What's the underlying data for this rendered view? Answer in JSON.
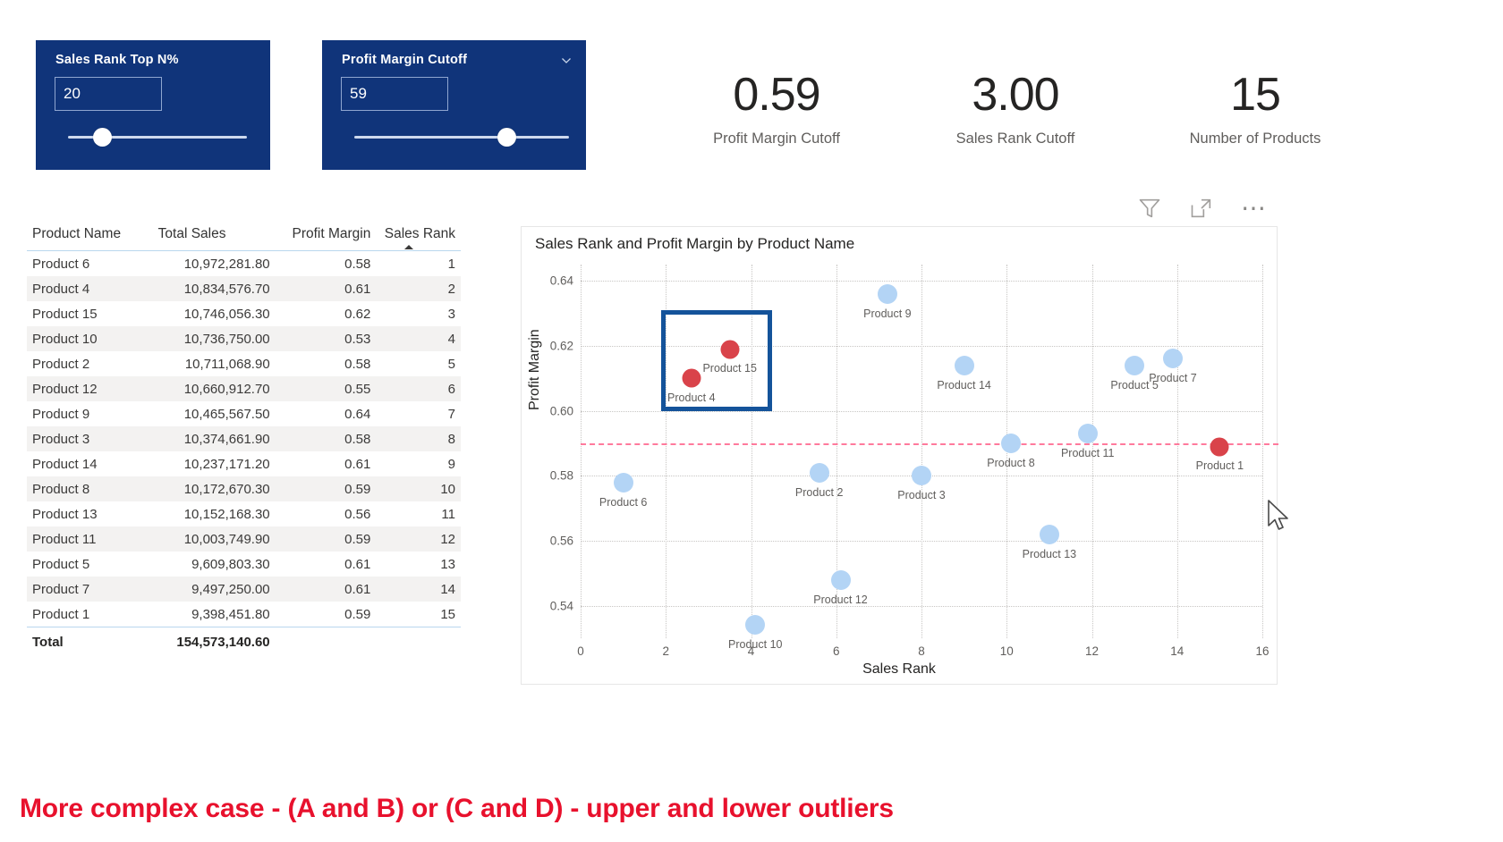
{
  "slicers": [
    {
      "name": "sales-rank-top-n",
      "title": "Sales Rank Top N%",
      "value": "20",
      "knob_pct": 19,
      "has_chevron": false
    },
    {
      "name": "profit-margin-cutoff",
      "title": "Profit Margin Cutoff",
      "value": "59",
      "knob_pct": 59,
      "has_chevron": true
    }
  ],
  "kpis": [
    {
      "value": "0.59",
      "label": "Profit Margin Cutoff"
    },
    {
      "value": "3.00",
      "label": "Sales Rank Cutoff"
    },
    {
      "value": "15",
      "label": "Number of Products"
    }
  ],
  "table": {
    "columns": [
      "Product Name",
      "Total Sales",
      "Profit Margin",
      "Sales Rank"
    ],
    "sorted_column": "Sales Rank",
    "rows": [
      [
        "Product 6",
        "10,972,281.80",
        "0.58",
        "1"
      ],
      [
        "Product 4",
        "10,834,576.70",
        "0.61",
        "2"
      ],
      [
        "Product 15",
        "10,746,056.30",
        "0.62",
        "3"
      ],
      [
        "Product 10",
        "10,736,750.00",
        "0.53",
        "4"
      ],
      [
        "Product 2",
        "10,711,068.90",
        "0.58",
        "5"
      ],
      [
        "Product 12",
        "10,660,912.70",
        "0.55",
        "6"
      ],
      [
        "Product 9",
        "10,465,567.50",
        "0.64",
        "7"
      ],
      [
        "Product 3",
        "10,374,661.90",
        "0.58",
        "8"
      ],
      [
        "Product 14",
        "10,237,171.20",
        "0.61",
        "9"
      ],
      [
        "Product 8",
        "10,172,670.30",
        "0.59",
        "10"
      ],
      [
        "Product 13",
        "10,152,168.30",
        "0.56",
        "11"
      ],
      [
        "Product 11",
        "10,003,749.90",
        "0.59",
        "12"
      ],
      [
        "Product 5",
        "9,609,803.30",
        "0.61",
        "13"
      ],
      [
        "Product 7",
        "9,497,250.00",
        "0.61",
        "14"
      ],
      [
        "Product 1",
        "9,398,451.80",
        "0.59",
        "15"
      ]
    ],
    "total_label": "Total",
    "total_value": "154,573,140.60"
  },
  "scatter": {
    "title": "Sales Rank and Profit Margin by Product Name",
    "toolbar": [
      "filter-icon",
      "focus-mode-icon",
      "more-options-icon"
    ],
    "colors": {
      "point_normal": "#b3d4f5",
      "point_highlight": "#d9434a",
      "cutoff_line": "#ff7a9c",
      "selection_box": "#14539a"
    }
  },
  "chart_data": {
    "type": "scatter",
    "title": "Sales Rank and Profit Margin by Product Name",
    "xlabel": "Sales Rank",
    "ylabel": "Profit Margin",
    "xlim": [
      0,
      16
    ],
    "ylim": [
      0.53,
      0.645
    ],
    "xticks": [
      0,
      2,
      4,
      6,
      8,
      10,
      12,
      14,
      16
    ],
    "yticks": [
      0.54,
      0.56,
      0.58,
      0.6,
      0.62,
      0.64
    ],
    "grid": true,
    "legend": "none",
    "reference_lines": [
      {
        "name": "profit-margin-cutoff",
        "orientation": "horizontal",
        "y": 0.59,
        "style": "dashed",
        "color": "#ff7a9c"
      }
    ],
    "annotations": [
      {
        "name": "selection-rectangle",
        "x0": 1.9,
        "x1": 4.5,
        "y0": 0.6,
        "y1": 0.631
      }
    ],
    "points": [
      {
        "label": "Product 6",
        "x": 1,
        "y": 0.578,
        "color": "#b3d4f5",
        "highlight": false
      },
      {
        "label": "Product 4",
        "x": 2.6,
        "y": 0.61,
        "color": "#d9434a",
        "highlight": true
      },
      {
        "label": "Product 15",
        "x": 3.5,
        "y": 0.619,
        "color": "#d9434a",
        "highlight": true
      },
      {
        "label": "Product 2",
        "x": 5.6,
        "y": 0.581,
        "color": "#b3d4f5",
        "highlight": false
      },
      {
        "label": "Product 10",
        "x": 4.1,
        "y": 0.534,
        "color": "#b3d4f5",
        "highlight": false
      },
      {
        "label": "Product 12",
        "x": 6.1,
        "y": 0.548,
        "color": "#b3d4f5",
        "highlight": false
      },
      {
        "label": "Product 9",
        "x": 7.2,
        "y": 0.636,
        "color": "#b3d4f5",
        "highlight": false
      },
      {
        "label": "Product 3",
        "x": 8.0,
        "y": 0.58,
        "color": "#b3d4f5",
        "highlight": false
      },
      {
        "label": "Product 14",
        "x": 9.0,
        "y": 0.614,
        "color": "#b3d4f5",
        "highlight": false
      },
      {
        "label": "Product 8",
        "x": 10.1,
        "y": 0.59,
        "color": "#b3d4f5",
        "highlight": false
      },
      {
        "label": "Product 13",
        "x": 11.0,
        "y": 0.562,
        "color": "#b3d4f5",
        "highlight": false
      },
      {
        "label": "Product 11",
        "x": 11.9,
        "y": 0.593,
        "color": "#b3d4f5",
        "highlight": false
      },
      {
        "label": "Product 5",
        "x": 13.0,
        "y": 0.614,
        "color": "#b3d4f5",
        "highlight": false
      },
      {
        "label": "Product 7",
        "x": 13.9,
        "y": 0.616,
        "color": "#b3d4f5",
        "highlight": false
      },
      {
        "label": "Product 1",
        "x": 15.0,
        "y": 0.589,
        "color": "#d9434a",
        "highlight": true
      }
    ]
  },
  "caption": "More complex case - (A and B) or (C and D) - upper and lower outliers"
}
